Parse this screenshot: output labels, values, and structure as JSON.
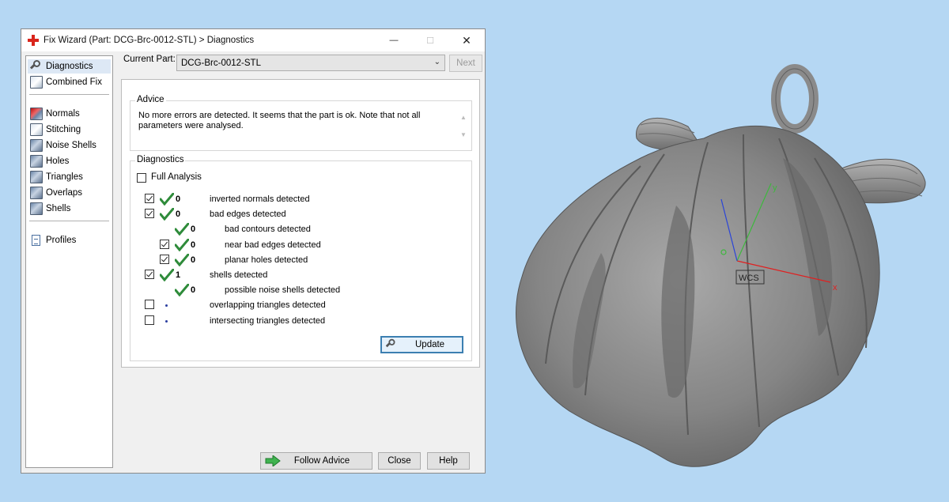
{
  "window": {
    "title": "Fix Wizard (Part: DCG-Brc-0012-STL) > Diagnostics",
    "min_glyph": "—",
    "max_glyph": "☐",
    "close_glyph": "✕"
  },
  "sidebar": {
    "items": [
      {
        "label": "Diagnostics",
        "icon": "magnifier-icon",
        "selected": true
      },
      {
        "label": "Combined Fix",
        "icon": "cube-icon"
      },
      {
        "label": "Normals",
        "icon": "normals-cube-icon"
      },
      {
        "label": "Stitching",
        "icon": "stitching-icon"
      },
      {
        "label": "Noise Shells",
        "icon": "noise-shells-icon"
      },
      {
        "label": "Holes",
        "icon": "holes-icon"
      },
      {
        "label": "Triangles",
        "icon": "triangles-icon"
      },
      {
        "label": "Overlaps",
        "icon": "overlaps-icon"
      },
      {
        "label": "Shells",
        "icon": "shells-icon"
      },
      {
        "label": "Profiles",
        "icon": "document-icon"
      }
    ]
  },
  "current_part": {
    "label": "Current Part:",
    "value": "DCG-Brc-0012-STL",
    "next_label": "Next"
  },
  "advice": {
    "title": "Advice",
    "text": "No more errors are detected. It seems that the part is ok. Note that not all parameters were analysed."
  },
  "diagnostics": {
    "title": "Diagnostics",
    "full_analysis_label": "Full Analysis",
    "full_analysis_checked": false,
    "rows": [
      {
        "checked": true,
        "status": "ok",
        "count": "0",
        "label": "inverted normals detected",
        "indent": 0
      },
      {
        "checked": true,
        "status": "ok",
        "count": "0",
        "label": "bad edges detected",
        "indent": 0
      },
      {
        "checked": null,
        "status": "ok",
        "count": "0",
        "label": "bad contours detected",
        "indent": 1
      },
      {
        "checked": true,
        "status": "ok",
        "count": "0",
        "label": "near bad edges detected",
        "indent": 1
      },
      {
        "checked": true,
        "status": "ok",
        "count": "0",
        "label": "planar holes detected",
        "indent": 1
      },
      {
        "checked": true,
        "status": "ok",
        "count": "1",
        "label": "shells detected",
        "indent": 0
      },
      {
        "checked": null,
        "status": "ok",
        "count": "0",
        "label": "possible noise shells detected",
        "indent": 1
      },
      {
        "checked": false,
        "status": "pending",
        "count": "",
        "label": "overlapping triangles detected",
        "indent": 0
      },
      {
        "checked": false,
        "status": "pending",
        "count": "",
        "label": "intersecting triangles detected",
        "indent": 0
      }
    ],
    "update_label": "Update"
  },
  "buttons": {
    "follow_advice": "Follow Advice",
    "close": "Close",
    "help": "Help"
  },
  "viewport": {
    "axis_x_label": "x",
    "axis_y_label": "y",
    "wcs_label": "WCS",
    "colors": {
      "x_axis": "#e02020",
      "y_axis": "#3db83d",
      "z_axis": "#2a44d8",
      "background": "#b5d7f3"
    }
  }
}
